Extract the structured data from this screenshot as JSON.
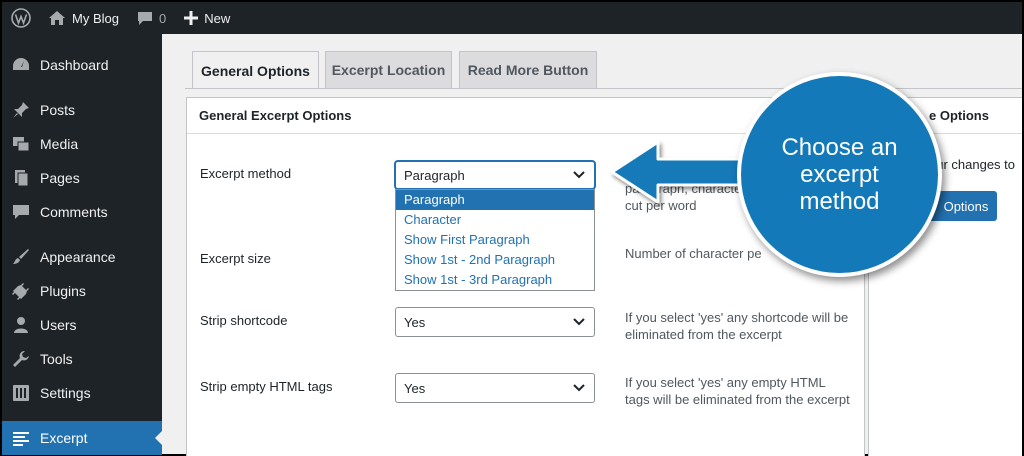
{
  "adminbar": {
    "site_name": "My Blog",
    "comments_count": "0",
    "new_label": "New"
  },
  "sidebar": {
    "items": [
      {
        "label": "Dashboard",
        "icon": "dashboard-icon"
      },
      {
        "label": "Posts",
        "icon": "pin-icon"
      },
      {
        "label": "Media",
        "icon": "media-icon"
      },
      {
        "label": "Pages",
        "icon": "pages-icon"
      },
      {
        "label": "Comments",
        "icon": "comment-icon"
      },
      {
        "label": "Appearance",
        "icon": "brush-icon"
      },
      {
        "label": "Plugins",
        "icon": "plug-icon"
      },
      {
        "label": "Users",
        "icon": "user-icon"
      },
      {
        "label": "Tools",
        "icon": "wrench-icon"
      },
      {
        "label": "Settings",
        "icon": "settings-icon"
      },
      {
        "label": "Excerpt",
        "icon": "excerpt-icon",
        "current": true
      }
    ]
  },
  "tabs": [
    "General Options",
    "Excerpt Location",
    "Read More Button"
  ],
  "main_panel": {
    "title": "General Excerpt Options",
    "rows": [
      {
        "label": "Excerpt method",
        "value": "Paragraph",
        "description_line1": "paragraph, character",
        "description_line2": "cut per word"
      },
      {
        "label": "Excerpt size",
        "description": "Number of character pe"
      },
      {
        "label": "Strip shortcode",
        "value": "Yes",
        "description": "If you select 'yes' any shortcode will be eliminated from the excerpt"
      },
      {
        "label": "Strip empty HTML tags",
        "value": "Yes",
        "description": "If you select 'yes' any empty HTML tags will be eliminated from the excerpt"
      }
    ],
    "dropdown_options": [
      "Paragraph",
      "Character",
      "Show First Paragraph",
      "Show 1st - 2nd Paragraph",
      "Show 1st - 3rd Paragraph"
    ]
  },
  "side_panel": {
    "title_partial": "e Options",
    "text_partial": "our changes to",
    "button_partial": "Options"
  },
  "callout": {
    "text": "Choose an excerpt method"
  },
  "colors": {
    "accent": "#2271b1",
    "admin_dark": "#1d2327",
    "callout_blue": "#1479b8"
  }
}
